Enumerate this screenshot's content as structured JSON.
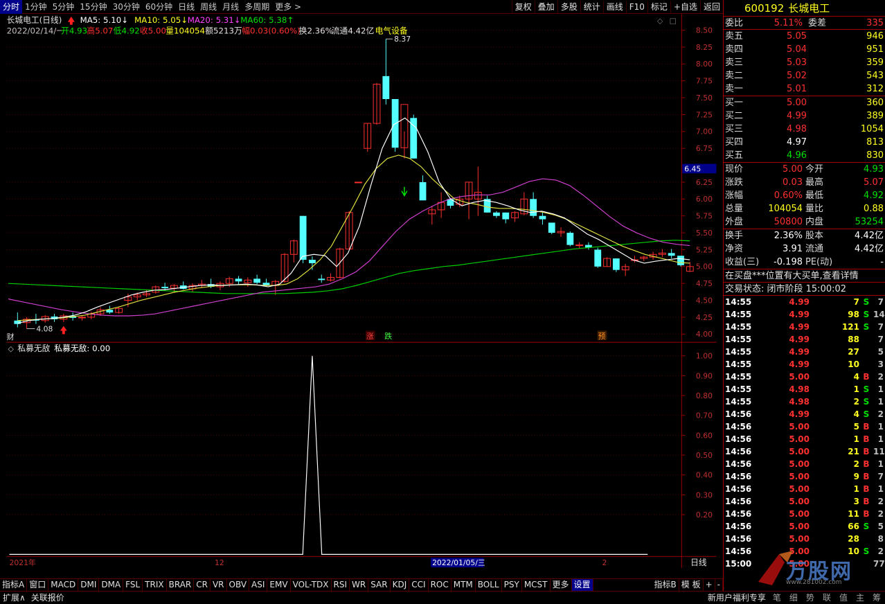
{
  "topbar": {
    "tabs": [
      "分时",
      "1分钟",
      "5分钟",
      "15分钟",
      "30分钟",
      "60分钟",
      "日线",
      "周线",
      "月线",
      "多周期",
      "更多 >"
    ],
    "active": 0,
    "buttons": [
      "复权",
      "叠加",
      "多股",
      "统计",
      "画线",
      "F10",
      "标记",
      "+自选",
      "返回"
    ]
  },
  "chart": {
    "title": "长城电工(日线)",
    "ma": [
      {
        "label": "MA5: 5.10↓",
        "color": "#ffffff"
      },
      {
        "label": "MA10: 5.05↓",
        "color": "#ffff20"
      },
      {
        "label": "MA20: 5.31↓",
        "color": "#ff40ff"
      },
      {
        "label": "MA60: 5.38↑",
        "color": "#00e000"
      }
    ],
    "info": {
      "date": "2022/02/14/一",
      "open": "开4.93",
      "high": "高5.07",
      "low": "低4.92",
      "close": "收5.00",
      "vol": "量104054",
      "amt": "额5213万",
      "chg": "幅0.03(0.60%)",
      "turn": "换2.36%",
      "float": "流通4.42亿",
      "sector": "电气设备"
    },
    "price_axis": [
      "8.50",
      "8.25",
      "8.00",
      "7.75",
      "7.50",
      "7.25",
      "7.00",
      "6.75",
      "6.45",
      "6.25",
      "6.00",
      "5.75",
      "5.50",
      "5.25",
      "5.00",
      "4.75",
      "4.50",
      "4.25",
      "4.00"
    ],
    "current_marker": "6.45",
    "high_label": "8.37",
    "low_label": "4.08",
    "markers": {
      "cai": "财",
      "zhang": "涨",
      "die": "跌",
      "yu": "预"
    },
    "candles": [
      [
        4.2,
        4.32,
        4.1,
        4.15
      ],
      [
        4.17,
        4.25,
        4.08,
        4.22
      ],
      [
        4.22,
        4.3,
        4.15,
        4.2
      ],
      [
        4.2,
        4.28,
        4.17,
        4.26
      ],
      [
        4.26,
        4.3,
        4.18,
        4.22
      ],
      [
        4.22,
        4.3,
        4.18,
        4.27
      ],
      [
        4.27,
        4.32,
        4.2,
        4.24
      ],
      [
        4.24,
        4.28,
        4.2,
        4.25
      ],
      [
        4.25,
        4.33,
        4.22,
        4.3
      ],
      [
        4.3,
        4.4,
        4.27,
        4.36
      ],
      [
        4.36,
        4.42,
        4.3,
        4.32
      ],
      [
        4.32,
        4.4,
        4.3,
        4.38
      ],
      [
        4.5,
        4.6,
        4.4,
        4.55
      ],
      [
        4.55,
        4.62,
        4.5,
        4.58
      ],
      [
        4.58,
        4.65,
        4.55,
        4.6
      ],
      [
        4.62,
        4.72,
        4.6,
        4.7
      ],
      [
        4.7,
        4.76,
        4.64,
        4.68
      ],
      [
        4.68,
        4.74,
        4.62,
        4.72
      ],
      [
        4.72,
        4.78,
        4.66,
        4.67
      ],
      [
        4.67,
        4.75,
        4.62,
        4.72
      ],
      [
        4.72,
        4.8,
        4.68,
        4.74
      ],
      [
        4.74,
        4.82,
        4.68,
        4.7
      ],
      [
        4.7,
        4.78,
        4.65,
        4.75
      ],
      [
        4.75,
        4.85,
        4.7,
        4.82
      ],
      [
        4.82,
        4.86,
        4.74,
        4.78
      ],
      [
        4.76,
        4.84,
        4.7,
        4.8
      ],
      [
        4.82,
        4.88,
        4.74,
        4.76
      ],
      [
        4.76,
        4.82,
        4.7,
        4.72
      ],
      [
        4.72,
        4.8,
        4.58,
        4.78
      ],
      [
        4.78,
        5.2,
        4.76,
        5.18
      ],
      [
        5.18,
        5.4,
        5.06,
        5.38
      ],
      [
        5.75,
        5.75,
        5.05,
        5.1
      ],
      [
        5.1,
        5.15,
        4.95,
        5.05
      ],
      [
        4.82,
        4.88,
        4.76,
        4.8
      ],
      [
        4.8,
        4.9,
        4.78,
        4.84
      ],
      [
        4.84,
        5.28,
        4.82,
        5.26
      ],
      [
        5.26,
        5.82,
        5.26,
        5.8
      ],
      [
        6.25,
        6.25,
        6.25,
        6.25
      ],
      [
        6.75,
        7.12,
        6.7,
        7.12
      ],
      [
        7.12,
        7.72,
        7.1,
        7.7
      ],
      [
        7.82,
        8.37,
        7.4,
        7.48
      ],
      [
        7.48,
        7.48,
        6.7,
        6.76
      ],
      [
        6.76,
        7.0,
        6.6,
        7.4
      ],
      [
        7.2,
        7.25,
        6.6,
        6.6
      ],
      [
        6.25,
        6.35,
        5.98,
        5.98
      ],
      [
        5.78,
        5.9,
        5.62,
        5.84
      ],
      [
        5.84,
        6.1,
        5.72,
        5.95
      ],
      [
        6.0,
        6.0,
        5.86,
        5.9
      ],
      [
        5.92,
        6.05,
        5.88,
        6.0
      ],
      [
        6.0,
        6.25,
        5.7,
        6.25
      ],
      [
        6.0,
        6.48,
        5.75,
        6.1
      ],
      [
        6.0,
        6.05,
        5.8,
        5.8
      ],
      [
        5.8,
        5.82,
        5.72,
        5.75
      ],
      [
        5.8,
        5.8,
        5.64,
        5.7
      ],
      [
        5.72,
        5.82,
        5.66,
        5.8
      ],
      [
        5.78,
        6.1,
        5.76,
        6.0
      ],
      [
        6.0,
        6.1,
        5.72,
        5.75
      ],
      [
        5.75,
        5.8,
        5.62,
        5.7
      ],
      [
        5.65,
        5.65,
        5.48,
        5.5
      ],
      [
        5.5,
        5.58,
        5.44,
        5.52
      ],
      [
        5.5,
        5.52,
        5.3,
        5.32
      ],
      [
        5.32,
        5.36,
        5.27,
        5.32
      ],
      [
        5.32,
        5.36,
        5.25,
        5.28
      ],
      [
        5.25,
        5.28,
        4.98,
        5.0
      ],
      [
        5.0,
        5.14,
        5.0,
        5.12
      ],
      [
        5.12,
        5.12,
        4.92,
        4.95
      ],
      [
        4.95,
        5.04,
        4.86,
        5.0
      ],
      [
        5.1,
        5.16,
        5.06,
        5.1
      ],
      [
        5.12,
        5.16,
        5.08,
        5.14
      ],
      [
        5.14,
        5.22,
        5.1,
        5.18
      ],
      [
        5.18,
        5.26,
        5.14,
        5.2
      ],
      [
        5.2,
        5.26,
        5.12,
        5.16
      ],
      [
        5.16,
        5.16,
        5.0,
        5.02
      ],
      [
        4.93,
        5.07,
        4.92,
        5.0
      ]
    ],
    "ma5": [
      4.16,
      4.2,
      4.22,
      4.23,
      4.25,
      4.28,
      4.33,
      4.4,
      4.46,
      4.52,
      4.58,
      4.62,
      4.65,
      4.66,
      4.68,
      4.7,
      4.72,
      4.73,
      4.72,
      4.73,
      4.74,
      4.73,
      4.7,
      4.74,
      4.9,
      5.15,
      5.18,
      5.16,
      5.0,
      5.2,
      5.6,
      6.2,
      6.75,
      7.1,
      7.2,
      7.05,
      6.7,
      6.25,
      6.0,
      5.9,
      5.95,
      5.98,
      5.95,
      5.9,
      5.84,
      5.8,
      5.82,
      5.78,
      5.72,
      5.6,
      5.48,
      5.4,
      5.3,
      5.2,
      5.1,
      5.05,
      5.08,
      5.1,
      5.12,
      5.1
    ],
    "ma10": [
      4.2,
      4.21,
      4.22,
      4.23,
      4.24,
      4.26,
      4.28,
      4.32,
      4.36,
      4.4,
      4.45,
      4.5,
      4.54,
      4.58,
      4.62,
      4.65,
      4.68,
      4.7,
      4.72,
      4.73,
      4.73,
      4.73,
      4.72,
      4.72,
      4.74,
      4.82,
      4.95,
      5.1,
      5.3,
      5.6,
      5.9,
      6.22,
      6.45,
      6.6,
      6.65,
      6.6,
      6.48,
      6.3,
      6.15,
      6.0,
      5.95,
      5.92,
      5.88,
      5.86,
      5.86,
      5.85,
      5.83,
      5.8,
      5.76,
      5.7,
      5.62,
      5.54,
      5.46,
      5.38,
      5.3,
      5.24,
      5.18,
      5.14,
      5.1,
      5.06,
      5.05
    ],
    "ma20": [
      4.52,
      4.48,
      4.44,
      4.4,
      4.36,
      4.33,
      4.3,
      4.28,
      4.27,
      4.27,
      4.28,
      4.3,
      4.34,
      4.38,
      4.42,
      4.46,
      4.5,
      4.54,
      4.58,
      4.62,
      4.64,
      4.66,
      4.68,
      4.7,
      4.74,
      4.82,
      4.92,
      5.08,
      5.3,
      5.52,
      5.7,
      5.82,
      5.92,
      6.0,
      6.04,
      6.06,
      6.06,
      6.1,
      6.18,
      6.26,
      6.3,
      6.28,
      6.2,
      6.06,
      5.9,
      5.74,
      5.6,
      5.5,
      5.42,
      5.36,
      5.33,
      5.31
    ],
    "ma60": [
      4.75,
      4.74,
      4.73,
      4.72,
      4.71,
      4.7,
      4.69,
      4.68,
      4.67,
      4.66,
      4.65,
      4.64,
      4.63,
      4.62,
      4.61,
      4.6,
      4.6,
      4.6,
      4.6,
      4.6,
      4.61,
      4.62,
      4.64,
      4.67,
      4.72,
      4.78,
      4.84,
      4.9,
      4.94,
      4.97,
      5.0,
      5.02,
      5.05,
      5.08,
      5.11,
      5.14,
      5.17,
      5.2,
      5.23,
      5.26,
      5.28,
      5.3,
      5.32,
      5.34,
      5.36,
      5.38,
      5.39,
      5.38
    ],
    "time_axis": {
      "left": "2021年",
      "mid": "12",
      "cursor": "2022/01/05/三",
      "right": "2"
    },
    "period": "日线"
  },
  "indicator": {
    "name": "私募无敌",
    "value_label": "私募无敌: 0.00",
    "axis": [
      "1.00",
      "0.90",
      "0.80",
      "0.70",
      "0.60",
      "0.50",
      "0.40",
      "0.30",
      "0.20"
    ],
    "spike_index": 32,
    "spike_value": 1.0
  },
  "indicator_tabs": [
    "指标A",
    "窗口",
    "MACD",
    "DMI",
    "DMA",
    "FSL",
    "TRIX",
    "BRAR",
    "CR",
    "VR",
    "OBV",
    "ASI",
    "EMV",
    "VOL-TDX",
    "RSI",
    "WR",
    "SAR",
    "KDJ",
    "CCI",
    "ROC",
    "MTM",
    "BOLL",
    "PSY",
    "MCST",
    "更多",
    "设置"
  ],
  "indicator_tabs_right": [
    "指标B",
    "模 板",
    "+",
    "-"
  ],
  "status": {
    "left": [
      "扩展∧",
      "关联报价"
    ],
    "right": "新用户福利专享",
    "icons": [
      "笔",
      "细",
      "势",
      "联",
      "值",
      "主",
      "筹"
    ]
  },
  "quote": {
    "code": "600192",
    "name": "长城电工",
    "weibi": {
      "label": "委比",
      "value": "5.11%",
      "label2": "委差",
      "value2": "335"
    },
    "sells": [
      {
        "label": "卖五",
        "price": "5.05",
        "vol": "946"
      },
      {
        "label": "卖四",
        "price": "5.04",
        "vol": "951"
      },
      {
        "label": "卖三",
        "price": "5.03",
        "vol": "359"
      },
      {
        "label": "卖二",
        "price": "5.02",
        "vol": "543"
      },
      {
        "label": "卖一",
        "price": "5.01",
        "vol": "312"
      }
    ],
    "buys": [
      {
        "label": "买一",
        "price": "5.00",
        "vol": "360",
        "c": "red"
      },
      {
        "label": "买二",
        "price": "4.99",
        "vol": "389",
        "c": "red"
      },
      {
        "label": "买三",
        "price": "4.98",
        "vol": "1054",
        "c": "red"
      },
      {
        "label": "买四",
        "price": "4.97",
        "vol": "813",
        "c": "wht"
      },
      {
        "label": "买五",
        "price": "4.96",
        "vol": "830",
        "c": "grn"
      }
    ],
    "stats": [
      {
        "l1": "现价",
        "v1": "5.00",
        "c1": "red",
        "l2": "今开",
        "v2": "4.93",
        "c2": "grn"
      },
      {
        "l1": "涨跌",
        "v1": "0.03",
        "c1": "red",
        "l2": "最高",
        "v2": "5.07",
        "c2": "red"
      },
      {
        "l1": "涨幅",
        "v1": "0.60%",
        "c1": "red",
        "l2": "最低",
        "v2": "4.92",
        "c2": "grn"
      },
      {
        "l1": "总量",
        "v1": "104054",
        "c1": "yel",
        "l2": "量比",
        "v2": "0.88",
        "c2": "yel"
      },
      {
        "l1": "外盘",
        "v1": "50800",
        "c1": "red",
        "l2": "内盘",
        "v2": "53254",
        "c2": "grn"
      }
    ],
    "stats2": [
      {
        "l1": "换手",
        "v1": "2.36%",
        "l2": "股本",
        "v2": "4.42亿"
      },
      {
        "l1": "净资",
        "v1": "3.91",
        "l2": "流通",
        "v2": "4.42亿"
      },
      {
        "l1": "收益(三)",
        "v1": "-0.198",
        "l2": "PE(动)",
        "v2": "-"
      }
    ],
    "notice": "在买盘***位置有大买单,查看详情",
    "trade_state": "交易状态: 闭市阶段 15:00:02",
    "ticks": [
      [
        "14:55",
        "4.99",
        "7",
        "S",
        "7"
      ],
      [
        "14:55",
        "4.99",
        "98",
        "S",
        "14"
      ],
      [
        "14:55",
        "4.99",
        "121",
        "S",
        "7"
      ],
      [
        "14:55",
        "4.99",
        "88",
        "",
        "7"
      ],
      [
        "14:55",
        "4.99",
        "27",
        "",
        "5"
      ],
      [
        "14:55",
        "4.99",
        "10",
        "",
        "3"
      ],
      [
        "14:55",
        "5.00",
        "4",
        "B",
        "2"
      ],
      [
        "14:55",
        "4.98",
        "1",
        "S",
        "1"
      ],
      [
        "14:55",
        "4.98",
        "2",
        "S",
        "1"
      ],
      [
        "14:56",
        "4.99",
        "4",
        "S",
        "2"
      ],
      [
        "14:56",
        "5.00",
        "5",
        "B",
        "1"
      ],
      [
        "14:56",
        "5.00",
        "1",
        "B",
        "1"
      ],
      [
        "14:56",
        "5.00",
        "21",
        "B",
        "11"
      ],
      [
        "14:56",
        "5.00",
        "2",
        "B",
        "1"
      ],
      [
        "14:56",
        "5.00",
        "9",
        "B",
        "7"
      ],
      [
        "14:56",
        "5.00",
        "1",
        "B",
        "1"
      ],
      [
        "14:56",
        "5.00",
        "3",
        "B",
        "2"
      ],
      [
        "14:56",
        "5.00",
        "11",
        "B",
        "2"
      ],
      [
        "14:56",
        "5.00",
        "66",
        "S",
        "5"
      ],
      [
        "14:56",
        "5.00",
        "28",
        "",
        "8"
      ],
      [
        "14:56",
        "5.00",
        "10",
        "S",
        "2"
      ],
      [
        "15:00",
        "5.00",
        "",
        "",
        "77"
      ]
    ],
    "watermark": "万股网",
    "watermark_url": "www.281002.com"
  }
}
